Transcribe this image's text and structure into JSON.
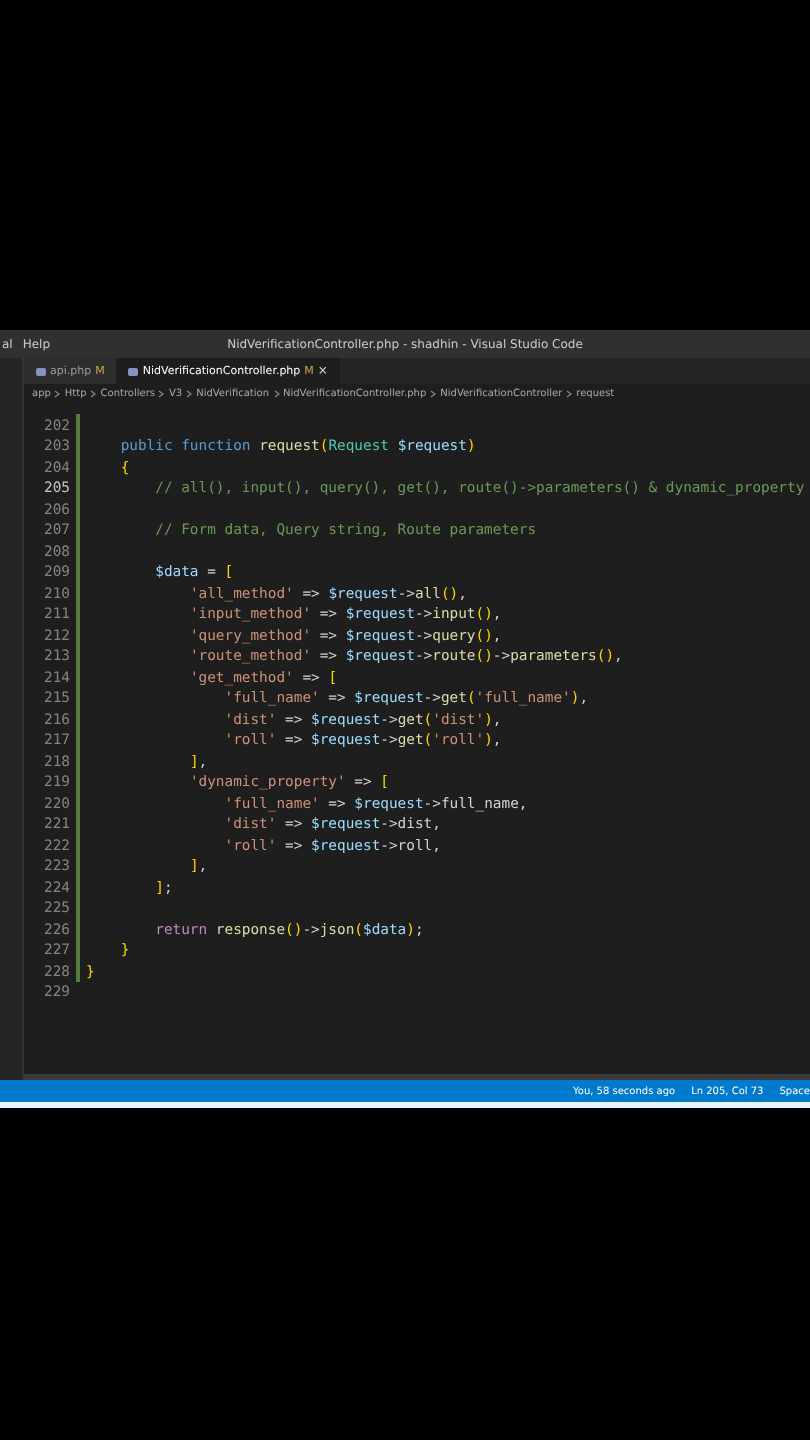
{
  "window": {
    "title": "NidVerificationController.php - shadhin - Visual Studio Code"
  },
  "menu": [
    "al",
    "Help"
  ],
  "tabs": [
    {
      "label": "api.php",
      "badge": "M",
      "selected": false
    },
    {
      "label": "NidVerificationController.php",
      "badge": "M",
      "selected": true,
      "close": "×"
    }
  ],
  "breadcrumbs": [
    "app",
    "Http",
    "Controllers",
    "V3",
    "NidVerification",
    "NidVerificationController.php",
    "NidVerificationController",
    "request"
  ],
  "code_lines": [
    {
      "number": "202",
      "current": false
    },
    {
      "number": "203",
      "text": "    public function request(Request $request)",
      "current": false
    },
    {
      "number": "204",
      "text": "    {",
      "current": false
    },
    {
      "number": "205",
      "text": "        // all(), input(), query(), get(), route()->parameters() & dynamic_property",
      "current": true
    },
    {
      "number": "206",
      "current": false
    },
    {
      "number": "207",
      "text": "        // Form data, Query string, Route parameters",
      "current": false
    },
    {
      "number": "208",
      "current": false
    },
    {
      "number": "209",
      "text": "        $data = [",
      "current": false
    },
    {
      "number": "210",
      "text": "            'all_method' => $request->all(),",
      "current": false
    },
    {
      "number": "211",
      "text": "            'input_method' => $request->input(),",
      "current": false
    },
    {
      "number": "212",
      "text": "            'query_method' => $request->query(),",
      "current": false
    },
    {
      "number": "213",
      "text": "            'route_method' => $request->route()->parameters(),",
      "current": false
    },
    {
      "number": "214",
      "text": "            'get_method' => [",
      "current": false
    },
    {
      "number": "215",
      "text": "                'full_name' => $request->get('full_name'),",
      "current": false
    },
    {
      "number": "216",
      "text": "                'dist' => $request->get('dist'),",
      "current": false
    },
    {
      "number": "217",
      "text": "                'roll' => $request->get('roll'),",
      "current": false
    },
    {
      "number": "218",
      "text": "            ],",
      "current": false
    },
    {
      "number": "219",
      "text": "            'dynamic_property' => [",
      "current": false
    },
    {
      "number": "220",
      "text": "                'full_name' => $request->full_name,",
      "current": false
    },
    {
      "number": "221",
      "text": "                'dist' => $request->dist,",
      "current": false
    },
    {
      "number": "222",
      "text": "                'roll' => $request->roll,",
      "current": false
    },
    {
      "number": "223",
      "text": "            ],",
      "current": false
    },
    {
      "number": "224",
      "text": "        ];",
      "current": false
    },
    {
      "number": "225",
      "current": false
    },
    {
      "number": "226",
      "text": "        return response()->json($data);",
      "current": false
    },
    {
      "number": "227",
      "text": "    }",
      "current": false
    },
    {
      "number": "228",
      "text": "}",
      "current": false
    },
    {
      "number": "229",
      "current": false
    }
  ],
  "status_bar": {
    "blame": "You, 58 seconds ago",
    "position": "Ln 205, Col 73",
    "indent": "Space"
  }
}
